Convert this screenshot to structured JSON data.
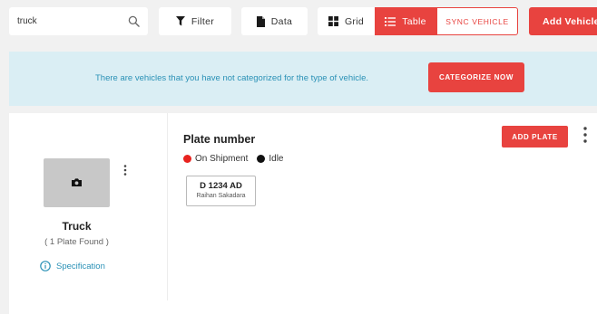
{
  "toolbar": {
    "search": {
      "value": "truck",
      "placeholder": ""
    },
    "filter_label": "Filter",
    "data_label": "Data",
    "grid_label": "Grid",
    "table_label": "Table",
    "sync_label": "SYNC VEHICLE",
    "add_label": "Add Vehicle"
  },
  "banner": {
    "text": "There are vehicles that you have not categorized for the type of vehicle.",
    "button_label": "CATEGORIZE NOW"
  },
  "vehicle": {
    "name": "Truck",
    "count_text": "( 1 Plate Found )",
    "spec_label": "Specification"
  },
  "plates": {
    "heading": "Plate number",
    "add_label": "ADD PLATE",
    "legend": {
      "on_shipment": "On Shipment",
      "idle": "Idle"
    },
    "items": [
      {
        "number": "D 1234 AD",
        "driver": "Raihan Sakadara",
        "status": "on-shipment"
      }
    ]
  },
  "colors": {
    "accent": "#e8433f",
    "info": "#2a91b6",
    "banner_bg": "#daeef4",
    "on_shipment": "#e8231f",
    "idle": "#111111"
  },
  "icons": {
    "search": "search-icon",
    "filter": "filter-icon",
    "data": "document-icon",
    "grid": "grid-icon",
    "table": "list-icon",
    "camera": "camera-icon",
    "kebab": "kebab-menu-icon",
    "info": "info-icon"
  }
}
